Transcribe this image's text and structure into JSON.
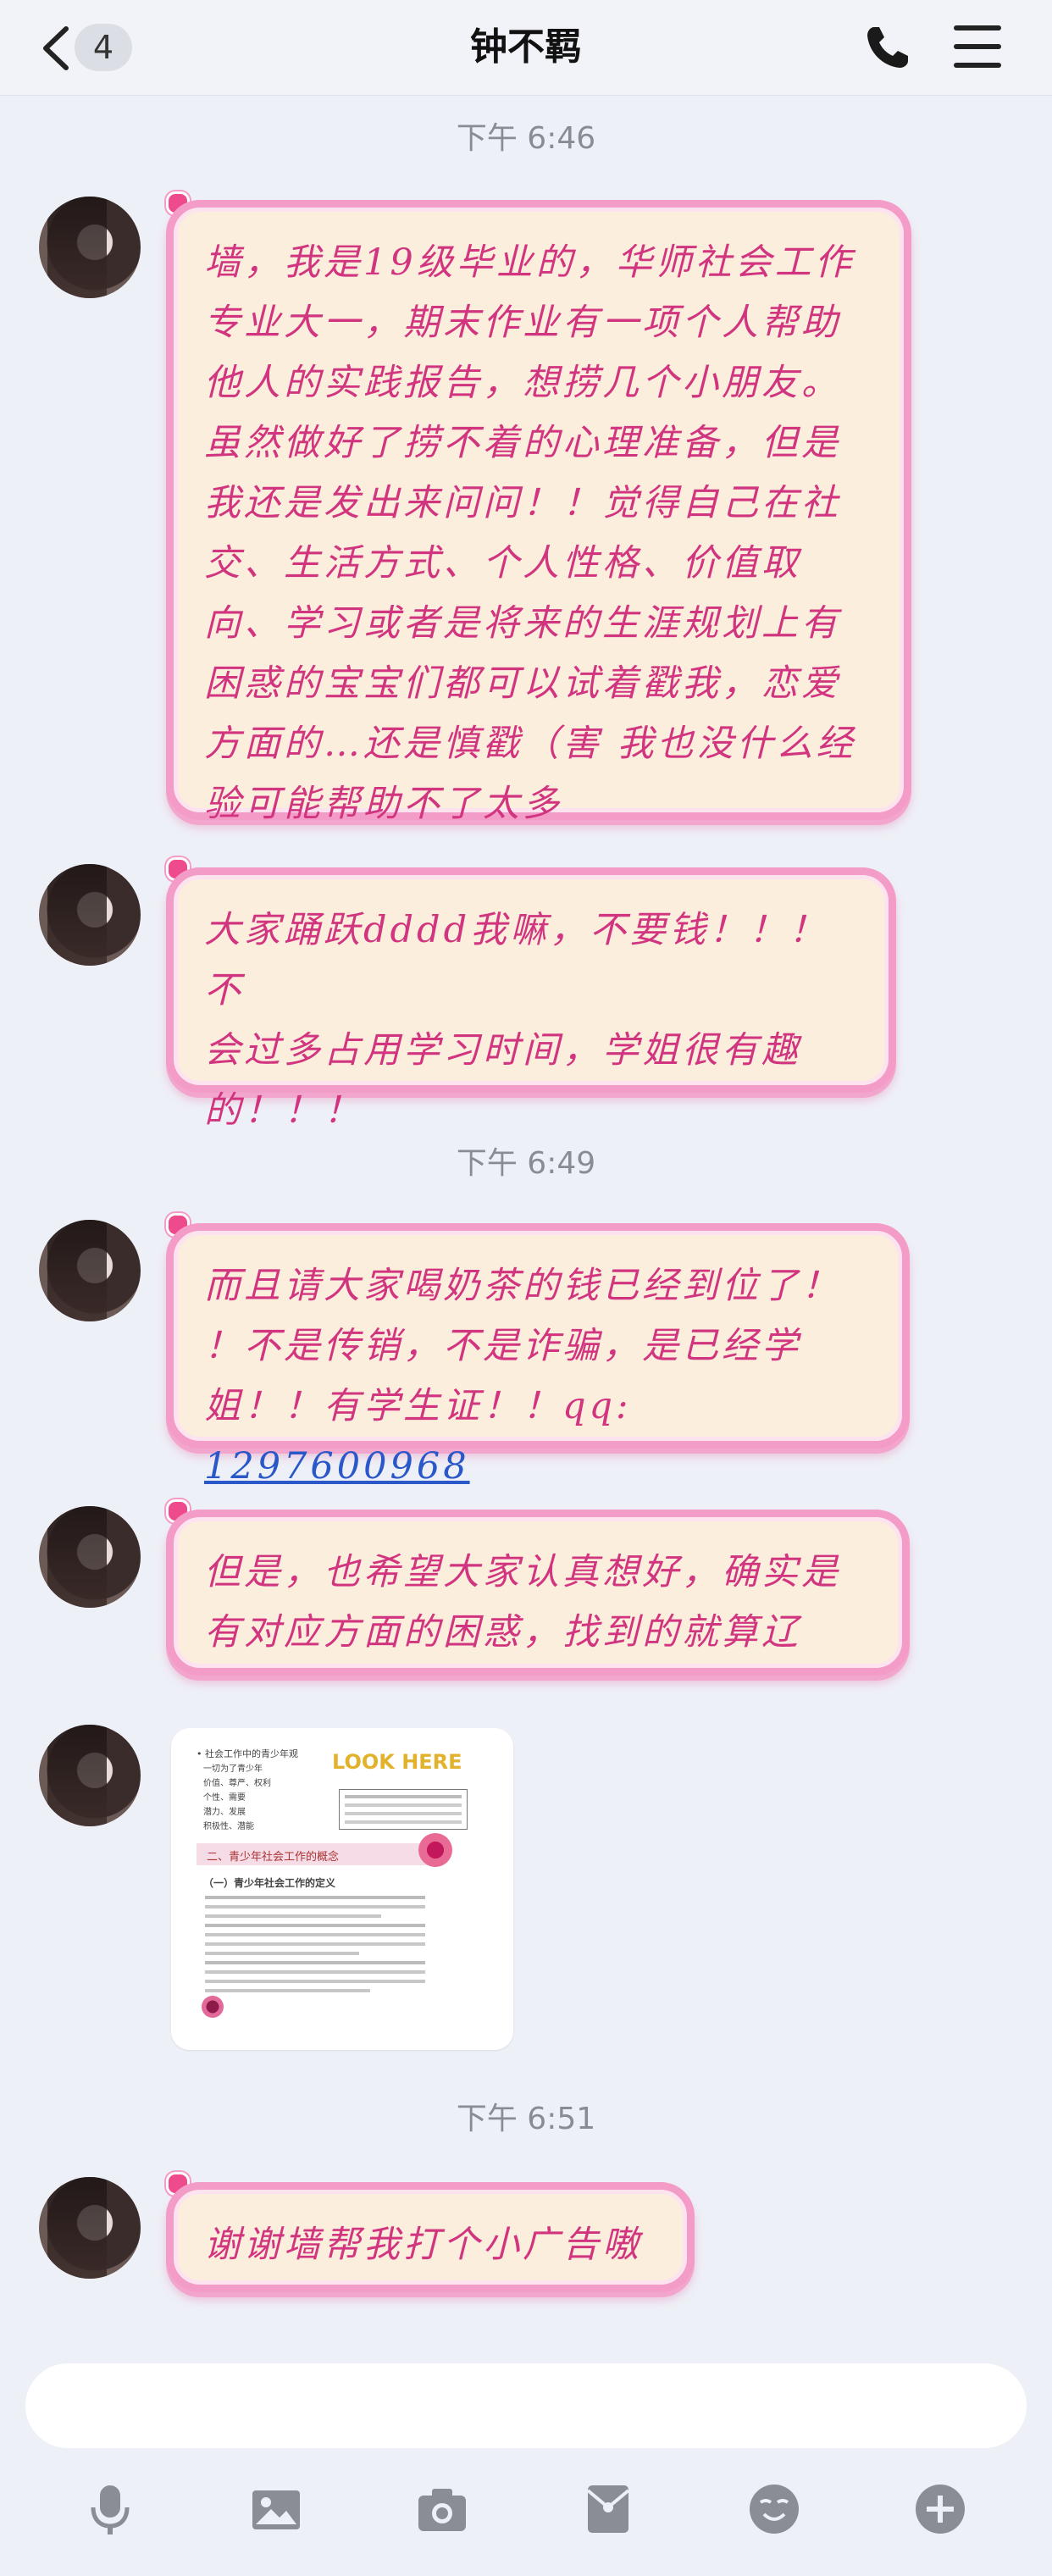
{
  "header": {
    "unread_count": "4",
    "title": "钟不羁",
    "icons": [
      "chevron-left-icon",
      "phone-icon",
      "menu-icon"
    ]
  },
  "colors": {
    "background": "#eef0f7",
    "bubble_fill": "#fbeedd",
    "bubble_border": "#f49cc8",
    "bubble_text": "#d2357f",
    "link": "#2a58c8"
  },
  "timestamps": [
    "下午 6:46",
    "下午 6:49",
    "下午 6:51"
  ],
  "messages": [
    {
      "lines": [
        "墙，我是19级毕业的，华师社会工作",
        "专业大一，期末作业有一项个人帮助",
        "他人的实践报告，想捞几个小朋友。",
        "虽然做好了捞不着的心理准备，但是",
        "我还是发出来问问！！觉得自己在社",
        "交、生活方式、个人性格、价值取",
        "向、学习或者是将来的生涯规划上有",
        "困惑的宝宝们都可以试着戳我，恋爱",
        "方面的…还是慎戳（害 我也没什么经",
        "验可能帮助不了太多"
      ]
    },
    {
      "lines": [
        "大家踊跃dddd我嘛，不要钱！！！不",
        "会过多占用学习时间，学姐很有趣",
        "的！！！"
      ]
    },
    {
      "lines": [
        "而且请大家喝奶茶的钱已经到位了！",
        "！不是传销，不是诈骗，是已经学",
        "姐！！有学生证！！qq: "
      ],
      "qq": "1297600968"
    },
    {
      "lines": [
        "但是，也希望大家认真想好，确实是",
        "有对应方面的困惑，找到的就算辽"
      ]
    },
    {
      "image": {
        "look_here": "LOOK HERE",
        "section_title": "二、青少年社会工作的概念",
        "subsection": "（一）青少年社会工作的定义",
        "top_note": "• 社会工作中的青少年观",
        "items": [
          "一切为了青少年",
          "价值、尊严、权利",
          "个性、需要",
          "潜力、发展",
          "积极性、潜能"
        ]
      }
    },
    {
      "lines": [
        "谢谢墙帮我打个小广告嗷"
      ]
    }
  ],
  "input": {
    "placeholder": ""
  },
  "toolbar": [
    "microphone-icon",
    "image-icon",
    "camera-icon",
    "red-packet-icon",
    "emoji-icon",
    "plus-icon"
  ]
}
